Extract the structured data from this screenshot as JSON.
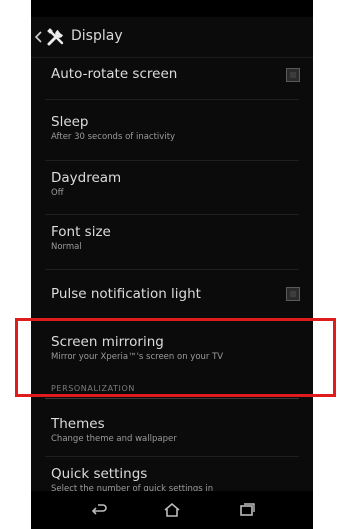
{
  "app": {
    "title": "Display"
  },
  "settings": {
    "auto_rotate": {
      "label": "Auto-rotate screen"
    },
    "sleep": {
      "label": "Sleep",
      "summary": "After 30 seconds of inactivity"
    },
    "daydream": {
      "label": "Daydream",
      "summary": "Off"
    },
    "font_size": {
      "label": "Font size",
      "summary": "Normal"
    },
    "pulse_light": {
      "label": "Pulse notification light"
    },
    "screen_mirroring": {
      "label": "Screen mirroring",
      "summary": "Mirror your Xperia™'s screen on your TV"
    },
    "personalization_header": "PERSONALIZATION",
    "themes": {
      "label": "Themes",
      "summary": "Change theme and wallpaper"
    },
    "quick_settings": {
      "label": "Quick settings",
      "summary": "Select the number of quick settings in"
    }
  },
  "colors": {
    "highlight": "#e01b1b",
    "background": "#0b0b0b"
  }
}
